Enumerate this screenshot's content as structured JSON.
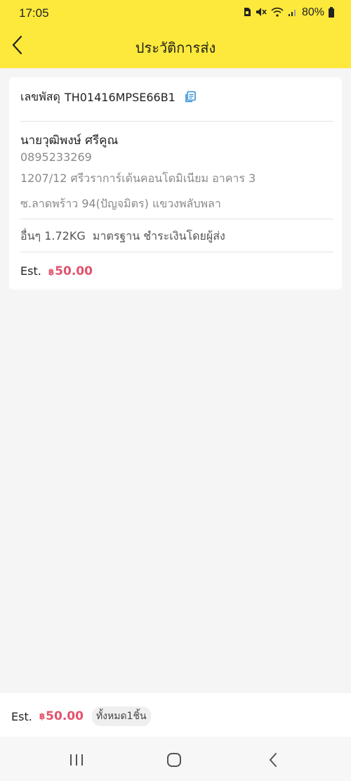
{
  "status_bar": {
    "time": "17:05",
    "battery_percent": "80%",
    "icons": [
      "sim-icon",
      "mute-icon",
      "wifi-icon",
      "signal-icon",
      "battery-icon"
    ]
  },
  "header": {
    "title": "ประวัติการส่ง",
    "back_icon": "chevron-left-icon"
  },
  "colors": {
    "header_bg": "#fde93b",
    "accent_price": "#e2526c",
    "copy_icon": "#2e8fd8",
    "page_bg": "#f5f5f5"
  },
  "shipment": {
    "tracking_label": "เลขพัสดุ",
    "tracking_number": "TH01416MPSE66B1",
    "recipient_name": "นายวุฒิพงษ์ ศรีคูณ",
    "recipient_phone": "0895233269",
    "address_line1": "1207/12 ศรีวราการ์เด้นคอนโดมิเนียม อาคาร 3",
    "address_line2": "ซ.ลาดพร้าว 94(ปัญจมิตร) แขวงพลับพลา",
    "details": "อื่นๆ 1.72KG  มาตรฐาน ชำระเงินโดยผู้ส่ง",
    "est_label": "Est.",
    "currency_symbol": "฿",
    "amount": "50.00"
  },
  "summary": {
    "est_label": "Est.",
    "currency_symbol": "฿",
    "amount": "50.00",
    "count_text": "ทั้งหมด1ชิ้น"
  },
  "nav": {
    "recents_icon": "recent-apps-icon",
    "home_icon": "home-icon",
    "back_icon": "back-icon"
  }
}
